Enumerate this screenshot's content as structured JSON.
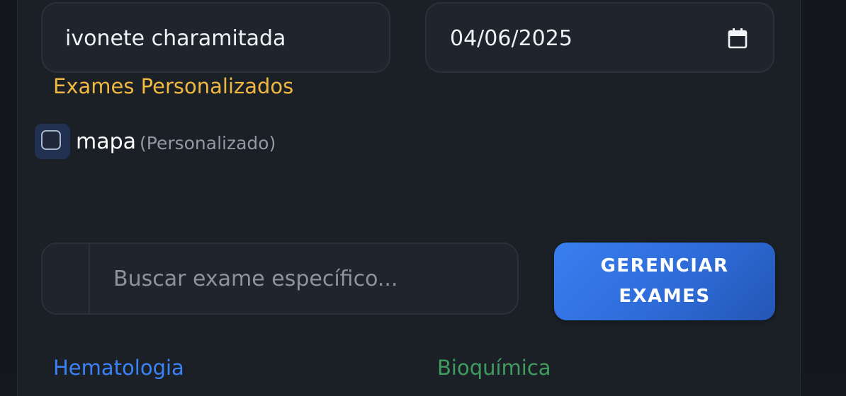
{
  "form": {
    "patient_name": "ivonete charamitada",
    "date": "04/06/2025",
    "date_icon": "calendar-icon"
  },
  "custom_exams": {
    "title": "Exames Personalizados",
    "items": [
      {
        "label": "mapa",
        "tag": "(Personalizado)",
        "checked": false
      }
    ]
  },
  "search": {
    "placeholder": "Buscar exame específico...",
    "value": ""
  },
  "manage_button": {
    "line1": "GERENCIAR",
    "line2": "EXAMES"
  },
  "categories": [
    {
      "label": "Hematologia",
      "color": "#3b82f6"
    },
    {
      "label": "Bioquímica",
      "color": "#3f9b5e"
    }
  ],
  "colors": {
    "accent_title": "#f0b840",
    "button_blue": "#2e6bd8",
    "background": "#1b2027"
  }
}
